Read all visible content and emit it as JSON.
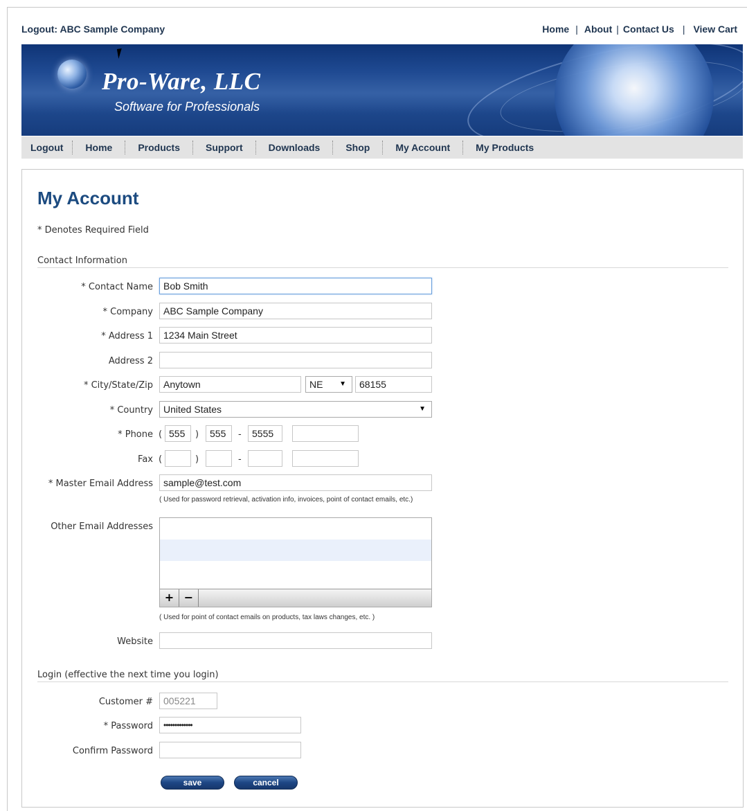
{
  "topbar": {
    "logout_text": "Logout: ABC Sample Company",
    "links": [
      "Home",
      "About",
      "Contact Us",
      "View Cart"
    ],
    "separator": "|"
  },
  "banner": {
    "brand": "Pro-Ware, LLC",
    "tagline": "Software for Professionals"
  },
  "nav": {
    "items": [
      "Logout",
      "Home",
      "Products",
      "Support",
      "Downloads",
      "Shop",
      "My Account",
      "My Products"
    ]
  },
  "page": {
    "title": "My Account",
    "required_note": "* Denotes Required Field"
  },
  "contact": {
    "section_title": "Contact Information",
    "contact_name_label": "* Contact Name",
    "contact_name_value": "Bob Smith",
    "company_label": "* Company",
    "company_value": "ABC Sample Company",
    "address1_label": "* Address 1",
    "address1_value": "1234 Main Street",
    "address2_label": "Address 2",
    "address2_value": "",
    "city_state_zip_label": "* City/State/Zip",
    "city_value": "Anytown",
    "state_value": "NE",
    "zip_value": "68155",
    "country_label": "* Country",
    "country_value": "United States",
    "phone_label": "* Phone",
    "phone_area": "555",
    "phone_prefix": "555",
    "phone_line": "5555",
    "phone_ext": "",
    "fax_label": "Fax",
    "fax_area": "",
    "fax_prefix": "",
    "fax_line": "",
    "fax_ext": "",
    "open_paren": "(",
    "close_paren": ")",
    "dash": "-",
    "master_email_label": "* Master Email Address",
    "master_email_value": "sample@test.com",
    "master_email_hint": "( Used for password retrieval, activation info, invoices, point of contact emails, etc.)",
    "other_emails_label": "Other Email Addresses",
    "add_symbol": "+",
    "remove_symbol": "−",
    "other_emails_hint": "( Used for point of contact emails on products, tax laws changes, etc. )",
    "website_label": "Website",
    "website_value": ""
  },
  "login": {
    "section_title": "Login (effective the next time you login)",
    "customer_label": "Customer #",
    "customer_value": "005221",
    "password_label": "* Password",
    "password_value": "•••••••••••••",
    "confirm_label": "Confirm Password",
    "confirm_value": ""
  },
  "buttons": {
    "save": "save",
    "cancel": "cancel"
  },
  "icons": {
    "state_dropdown": "dropdown-arrow-icon",
    "country_dropdown": "dropdown-arrow-icon",
    "globe": "globe-icon",
    "cursor": "mouse-cursor-icon"
  },
  "colors": {
    "brand_blue": "#1c4b80",
    "nav_text": "#1f3550",
    "banner_blue": "#1f4a92",
    "button_blue": "#1d4684"
  }
}
